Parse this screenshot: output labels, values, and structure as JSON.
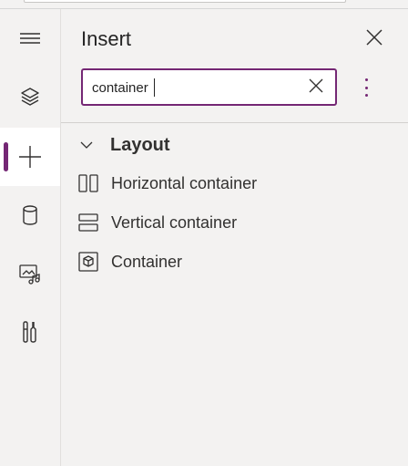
{
  "panel": {
    "title": "Insert",
    "search": {
      "value": "container",
      "placeholder": ""
    },
    "groups": [
      {
        "label": "Layout",
        "items": [
          {
            "label": "Horizontal container",
            "icon": "horizontal-container-icon"
          },
          {
            "label": "Vertical container",
            "icon": "vertical-container-icon"
          },
          {
            "label": "Container",
            "icon": "container-icon"
          }
        ]
      }
    ]
  },
  "rail": {
    "items": [
      {
        "icon": "hamburger-icon"
      },
      {
        "icon": "layers-icon"
      },
      {
        "icon": "plus-icon",
        "active": true
      },
      {
        "icon": "database-icon"
      },
      {
        "icon": "media-icon"
      },
      {
        "icon": "tools-icon"
      }
    ]
  },
  "colors": {
    "accent": "#742774",
    "background": "#f3f2f1",
    "text": "#323130"
  }
}
